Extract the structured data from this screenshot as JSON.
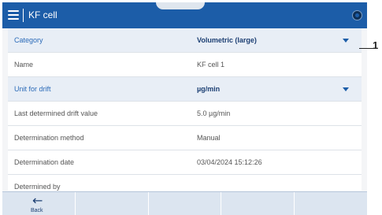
{
  "titlebar": {
    "title": "KF cell"
  },
  "rows": [
    {
      "label": "Category",
      "value": "Volumetric (large)"
    },
    {
      "label": "Name",
      "value": "KF cell 1"
    },
    {
      "label": "Unit for drift",
      "value": "µg/min"
    },
    {
      "label": "Last determined drift value",
      "value": "5.0 µg/min"
    },
    {
      "label": "Determination method",
      "value": "Manual"
    },
    {
      "label": "Determination date",
      "value": "03/04/2024  15:12:26"
    },
    {
      "label": "Determined by",
      "value": ""
    }
  ],
  "bottombar": {
    "back_label": "Back"
  },
  "callout": {
    "number": "1"
  }
}
